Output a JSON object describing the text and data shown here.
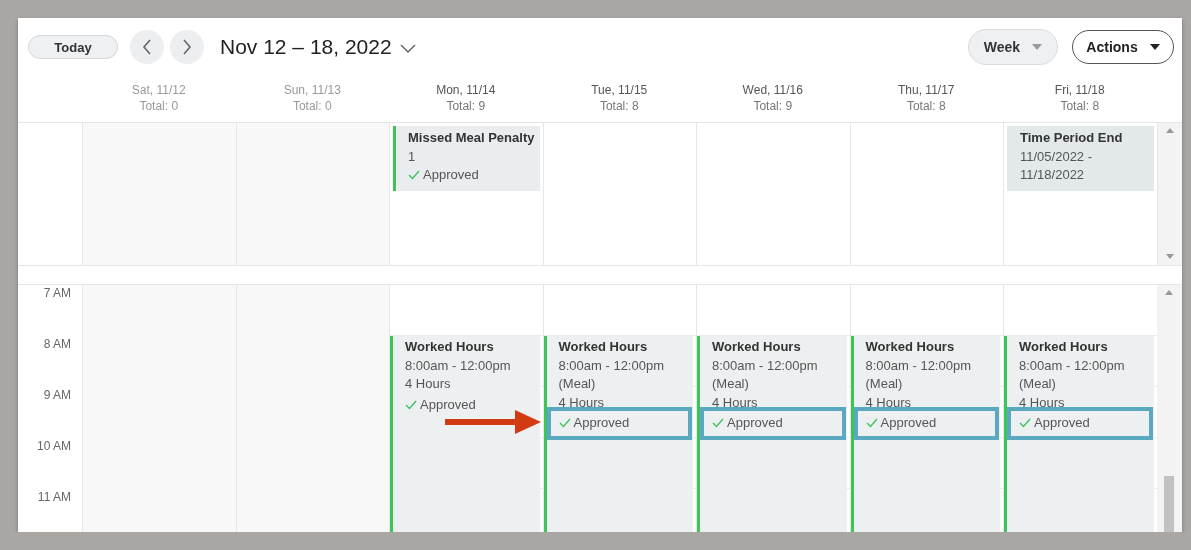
{
  "toolbar": {
    "today": "Today",
    "date_range": "Nov 12 – 18, 2022",
    "view": "Week",
    "actions": "Actions"
  },
  "days": [
    {
      "label": "Sat, 11/12",
      "total": "Total: 0",
      "weekend": true
    },
    {
      "label": "Sun, 11/13",
      "total": "Total: 0",
      "weekend": true
    },
    {
      "label": "Mon, 11/14",
      "total": "Total: 9",
      "weekend": false,
      "all_day": [
        {
          "kind": "entry",
          "title": "Missed Meal Penalty",
          "lines": [
            "1"
          ],
          "status": "Approved"
        }
      ],
      "events": [
        {
          "title": "Worked Hours",
          "lines": [
            "8:00am - 12:00pm",
            "4 Hours"
          ],
          "status": "Approved",
          "highlighted": false
        }
      ]
    },
    {
      "label": "Tue, 11/15",
      "total": "Total: 8",
      "weekend": false,
      "events": [
        {
          "title": "Worked Hours",
          "lines": [
            "8:00am - 12:00pm",
            "(Meal)",
            "4 Hours"
          ],
          "status": "Approved",
          "highlighted": true
        }
      ]
    },
    {
      "label": "Wed, 11/16",
      "total": "Total: 9",
      "weekend": false,
      "events": [
        {
          "title": "Worked Hours",
          "lines": [
            "8:00am - 12:00pm",
            "(Meal)",
            "4 Hours"
          ],
          "status": "Approved",
          "highlighted": true
        }
      ]
    },
    {
      "label": "Thu, 11/17",
      "total": "Total: 8",
      "weekend": false,
      "events": [
        {
          "title": "Worked Hours",
          "lines": [
            "8:00am - 12:00pm",
            "(Meal)",
            "4 Hours"
          ],
          "status": "Approved",
          "highlighted": true
        }
      ]
    },
    {
      "label": "Fri, 11/18",
      "total": "Total: 8",
      "weekend": false,
      "all_day": [
        {
          "kind": "period",
          "title": "Time Period End",
          "lines": [
            "11/05/2022 -",
            "11/18/2022"
          ]
        }
      ],
      "events": [
        {
          "title": "Worked Hours",
          "lines": [
            "8:00am - 12:00pm",
            "(Meal)",
            "4 Hours"
          ],
          "status": "Approved",
          "highlighted": true
        }
      ]
    }
  ],
  "time_labels": [
    "7 AM",
    "8 AM",
    "9 AM",
    "10 AM",
    "11 AM"
  ]
}
